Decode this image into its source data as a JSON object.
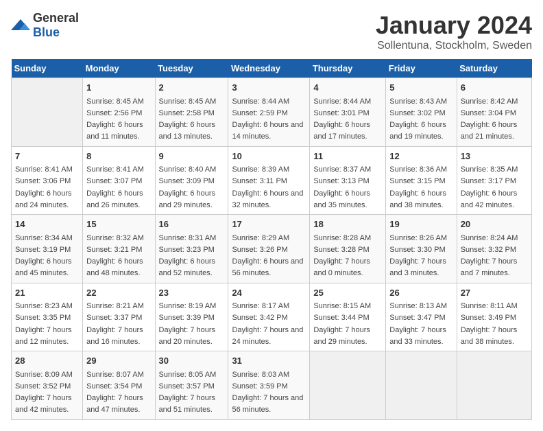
{
  "logo": {
    "text_general": "General",
    "text_blue": "Blue"
  },
  "title": "January 2024",
  "subtitle": "Sollentuna, Stockholm, Sweden",
  "days_header": [
    "Sunday",
    "Monday",
    "Tuesday",
    "Wednesday",
    "Thursday",
    "Friday",
    "Saturday"
  ],
  "weeks": [
    [
      {
        "day": "",
        "sunrise": "",
        "sunset": "",
        "daylight": ""
      },
      {
        "day": "1",
        "sunrise": "Sunrise: 8:45 AM",
        "sunset": "Sunset: 2:56 PM",
        "daylight": "Daylight: 6 hours and 11 minutes."
      },
      {
        "day": "2",
        "sunrise": "Sunrise: 8:45 AM",
        "sunset": "Sunset: 2:58 PM",
        "daylight": "Daylight: 6 hours and 13 minutes."
      },
      {
        "day": "3",
        "sunrise": "Sunrise: 8:44 AM",
        "sunset": "Sunset: 2:59 PM",
        "daylight": "Daylight: 6 hours and 14 minutes."
      },
      {
        "day": "4",
        "sunrise": "Sunrise: 8:44 AM",
        "sunset": "Sunset: 3:01 PM",
        "daylight": "Daylight: 6 hours and 17 minutes."
      },
      {
        "day": "5",
        "sunrise": "Sunrise: 8:43 AM",
        "sunset": "Sunset: 3:02 PM",
        "daylight": "Daylight: 6 hours and 19 minutes."
      },
      {
        "day": "6",
        "sunrise": "Sunrise: 8:42 AM",
        "sunset": "Sunset: 3:04 PM",
        "daylight": "Daylight: 6 hours and 21 minutes."
      }
    ],
    [
      {
        "day": "7",
        "sunrise": "Sunrise: 8:41 AM",
        "sunset": "Sunset: 3:06 PM",
        "daylight": "Daylight: 6 hours and 24 minutes."
      },
      {
        "day": "8",
        "sunrise": "Sunrise: 8:41 AM",
        "sunset": "Sunset: 3:07 PM",
        "daylight": "Daylight: 6 hours and 26 minutes."
      },
      {
        "day": "9",
        "sunrise": "Sunrise: 8:40 AM",
        "sunset": "Sunset: 3:09 PM",
        "daylight": "Daylight: 6 hours and 29 minutes."
      },
      {
        "day": "10",
        "sunrise": "Sunrise: 8:39 AM",
        "sunset": "Sunset: 3:11 PM",
        "daylight": "Daylight: 6 hours and 32 minutes."
      },
      {
        "day": "11",
        "sunrise": "Sunrise: 8:37 AM",
        "sunset": "Sunset: 3:13 PM",
        "daylight": "Daylight: 6 hours and 35 minutes."
      },
      {
        "day": "12",
        "sunrise": "Sunrise: 8:36 AM",
        "sunset": "Sunset: 3:15 PM",
        "daylight": "Daylight: 6 hours and 38 minutes."
      },
      {
        "day": "13",
        "sunrise": "Sunrise: 8:35 AM",
        "sunset": "Sunset: 3:17 PM",
        "daylight": "Daylight: 6 hours and 42 minutes."
      }
    ],
    [
      {
        "day": "14",
        "sunrise": "Sunrise: 8:34 AM",
        "sunset": "Sunset: 3:19 PM",
        "daylight": "Daylight: 6 hours and 45 minutes."
      },
      {
        "day": "15",
        "sunrise": "Sunrise: 8:32 AM",
        "sunset": "Sunset: 3:21 PM",
        "daylight": "Daylight: 6 hours and 48 minutes."
      },
      {
        "day": "16",
        "sunrise": "Sunrise: 8:31 AM",
        "sunset": "Sunset: 3:23 PM",
        "daylight": "Daylight: 6 hours and 52 minutes."
      },
      {
        "day": "17",
        "sunrise": "Sunrise: 8:29 AM",
        "sunset": "Sunset: 3:26 PM",
        "daylight": "Daylight: 6 hours and 56 minutes."
      },
      {
        "day": "18",
        "sunrise": "Sunrise: 8:28 AM",
        "sunset": "Sunset: 3:28 PM",
        "daylight": "Daylight: 7 hours and 0 minutes."
      },
      {
        "day": "19",
        "sunrise": "Sunrise: 8:26 AM",
        "sunset": "Sunset: 3:30 PM",
        "daylight": "Daylight: 7 hours and 3 minutes."
      },
      {
        "day": "20",
        "sunrise": "Sunrise: 8:24 AM",
        "sunset": "Sunset: 3:32 PM",
        "daylight": "Daylight: 7 hours and 7 minutes."
      }
    ],
    [
      {
        "day": "21",
        "sunrise": "Sunrise: 8:23 AM",
        "sunset": "Sunset: 3:35 PM",
        "daylight": "Daylight: 7 hours and 12 minutes."
      },
      {
        "day": "22",
        "sunrise": "Sunrise: 8:21 AM",
        "sunset": "Sunset: 3:37 PM",
        "daylight": "Daylight: 7 hours and 16 minutes."
      },
      {
        "day": "23",
        "sunrise": "Sunrise: 8:19 AM",
        "sunset": "Sunset: 3:39 PM",
        "daylight": "Daylight: 7 hours and 20 minutes."
      },
      {
        "day": "24",
        "sunrise": "Sunrise: 8:17 AM",
        "sunset": "Sunset: 3:42 PM",
        "daylight": "Daylight: 7 hours and 24 minutes."
      },
      {
        "day": "25",
        "sunrise": "Sunrise: 8:15 AM",
        "sunset": "Sunset: 3:44 PM",
        "daylight": "Daylight: 7 hours and 29 minutes."
      },
      {
        "day": "26",
        "sunrise": "Sunrise: 8:13 AM",
        "sunset": "Sunset: 3:47 PM",
        "daylight": "Daylight: 7 hours and 33 minutes."
      },
      {
        "day": "27",
        "sunrise": "Sunrise: 8:11 AM",
        "sunset": "Sunset: 3:49 PM",
        "daylight": "Daylight: 7 hours and 38 minutes."
      }
    ],
    [
      {
        "day": "28",
        "sunrise": "Sunrise: 8:09 AM",
        "sunset": "Sunset: 3:52 PM",
        "daylight": "Daylight: 7 hours and 42 minutes."
      },
      {
        "day": "29",
        "sunrise": "Sunrise: 8:07 AM",
        "sunset": "Sunset: 3:54 PM",
        "daylight": "Daylight: 7 hours and 47 minutes."
      },
      {
        "day": "30",
        "sunrise": "Sunrise: 8:05 AM",
        "sunset": "Sunset: 3:57 PM",
        "daylight": "Daylight: 7 hours and 51 minutes."
      },
      {
        "day": "31",
        "sunrise": "Sunrise: 8:03 AM",
        "sunset": "Sunset: 3:59 PM",
        "daylight": "Daylight: 7 hours and 56 minutes."
      },
      {
        "day": "",
        "sunrise": "",
        "sunset": "",
        "daylight": ""
      },
      {
        "day": "",
        "sunrise": "",
        "sunset": "",
        "daylight": ""
      },
      {
        "day": "",
        "sunrise": "",
        "sunset": "",
        "daylight": ""
      }
    ]
  ]
}
